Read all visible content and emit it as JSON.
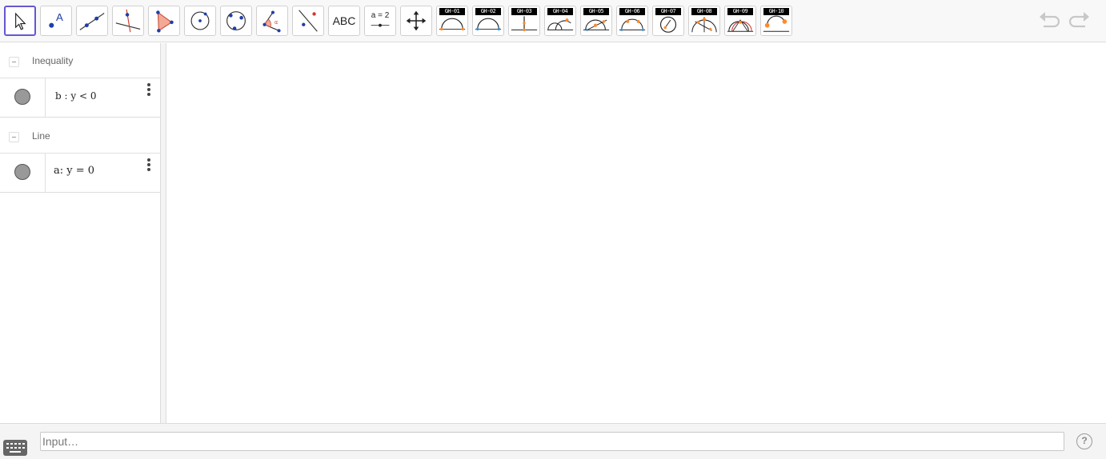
{
  "toolbar": {
    "tools": [
      {
        "name": "move-tool",
        "icon": "cursor-arrow-icon"
      },
      {
        "name": "point-tool",
        "icon": "point-icon"
      },
      {
        "name": "line-tool",
        "icon": "line-through-points-icon"
      },
      {
        "name": "perpendicular-line-tool",
        "icon": "perpendicular-line-icon"
      },
      {
        "name": "polygon-tool",
        "icon": "polygon-icon"
      },
      {
        "name": "circle-center-point-tool",
        "icon": "circle-center-icon"
      },
      {
        "name": "circle-three-points-tool",
        "icon": "circle-three-points-icon"
      },
      {
        "name": "angle-tool",
        "icon": "angle-icon"
      },
      {
        "name": "reflect-about-line-tool",
        "icon": "reflect-icon"
      },
      {
        "name": "text-tool",
        "label": "ABC"
      },
      {
        "name": "slider-tool",
        "label": "a = 2"
      },
      {
        "name": "move-graphics-view-tool",
        "icon": "move-arrows-icon"
      }
    ],
    "custom_tools": [
      "GH-01",
      "GH-02",
      "GH-03",
      "GH-04",
      "GH-05",
      "GH-06",
      "GH-07",
      "GH-08",
      "GH-09",
      "GH-10"
    ]
  },
  "algebra": {
    "groups": [
      {
        "label": "Inequality",
        "items": [
          {
            "text": "b : y < 0"
          }
        ]
      },
      {
        "label": "Line",
        "items": [
          {
            "text": "a: y = 0"
          }
        ]
      }
    ],
    "marble_color": "#999999"
  },
  "input": {
    "placeholder": "Input…"
  },
  "help": {
    "label": "?"
  },
  "colors": {
    "selected_tool_border": "#6557d2",
    "point_blue": "#1f3fa8",
    "accent_red": "#d0392c",
    "custom_tool_orange": "#ff8a2a"
  }
}
